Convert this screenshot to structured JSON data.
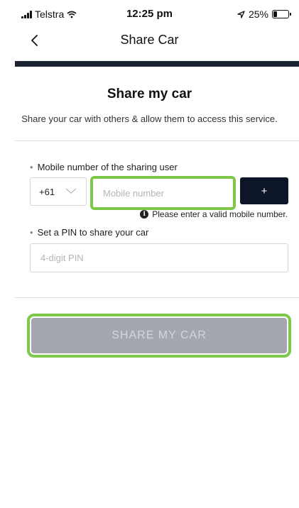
{
  "status_bar": {
    "carrier": "Telstra",
    "time": "12:25 pm",
    "battery": "25%",
    "battery_level": 0.25
  },
  "nav": {
    "title": "Share Car",
    "back_icon": "chevron-left-icon",
    "divider_color": "#1b2230"
  },
  "content": {
    "heading": "Share my car",
    "subtext": "Share your car with others & allow them to access this service."
  },
  "mobile": {
    "label": "Mobile number of the sharing user",
    "country_code": "+61",
    "placeholder": "Mobile number",
    "value": "",
    "add_label": "+",
    "error": "Please enter a valid mobile number.",
    "highlight_color": "#7fc749"
  },
  "pin": {
    "label": "Set a PIN to share your car",
    "placeholder": "4-digit PIN",
    "value": ""
  },
  "share_button": {
    "label": "SHARE MY CAR",
    "background": "#a4a7b0"
  },
  "colors": {
    "accent_dark": "#0d1629",
    "highlight_green": "#7fc749"
  }
}
